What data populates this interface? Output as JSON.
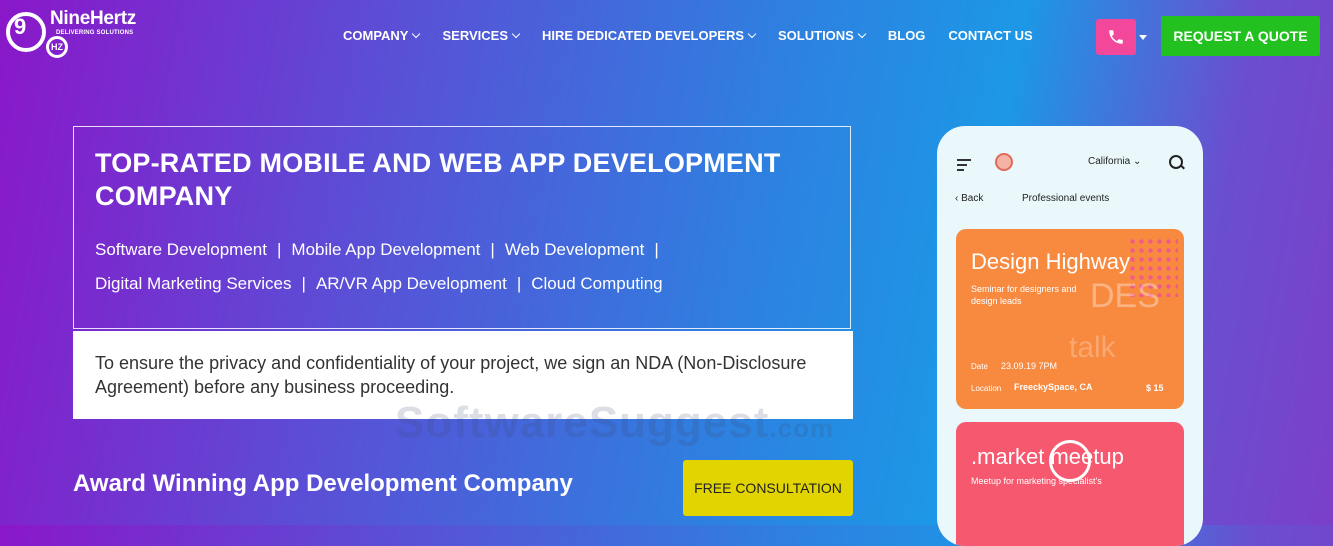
{
  "brand": {
    "name": "NineHertz",
    "tagline": "DELIVERING SOLUTIONS",
    "mark": "9",
    "badge": "HZ"
  },
  "nav": [
    {
      "label": "COMPANY",
      "dropdown": true
    },
    {
      "label": "SERVICES",
      "dropdown": true
    },
    {
      "label": "HIRE DEDICATED DEVELOPERS",
      "dropdown": true
    },
    {
      "label": "SOLUTIONS",
      "dropdown": true
    },
    {
      "label": "BLOG",
      "dropdown": false
    },
    {
      "label": "CONTACT US",
      "dropdown": false
    }
  ],
  "header": {
    "phone_icon": "phone-icon",
    "quote_label": "REQUEST A QUOTE"
  },
  "hero": {
    "title": "TOP-RATED MOBILE AND WEB APP DEVELOPMENT COMPANY",
    "services": [
      "Software Development",
      "Mobile App Development",
      "Web Development",
      "Digital Marketing Services",
      "AR/VR App Development",
      "Cloud Computing"
    ],
    "separator": "|",
    "nda_text": "To ensure the privacy and confidentiality of your project, we sign an NDA (Non-Disclosure Agreement) before any business proceeding."
  },
  "award": {
    "title": "Award Winning App Development Company"
  },
  "consult_label": "FREE CONSULTATION",
  "watermark": {
    "text": "SoftwareSuggest",
    "suffix": ".com"
  },
  "phone_app": {
    "location": "California",
    "back_label": "Back",
    "header": "Professional events",
    "card1": {
      "title": "Design Highway",
      "subtitle": "Seminar for designers and design leads",
      "bg_text": "DES",
      "bg_text2": "talk",
      "date_label": "Date",
      "date": "23.09.19 7PM",
      "location_label": "Location",
      "location": "FreeckySpace, CA",
      "price": "$ 15"
    },
    "card2": {
      "title": ".market meetup",
      "subtitle": "Meetup for marketing specialist's"
    }
  },
  "colors": {
    "quote": "#22c11f",
    "phone": "#f2479b",
    "consult": "#e2d400"
  }
}
